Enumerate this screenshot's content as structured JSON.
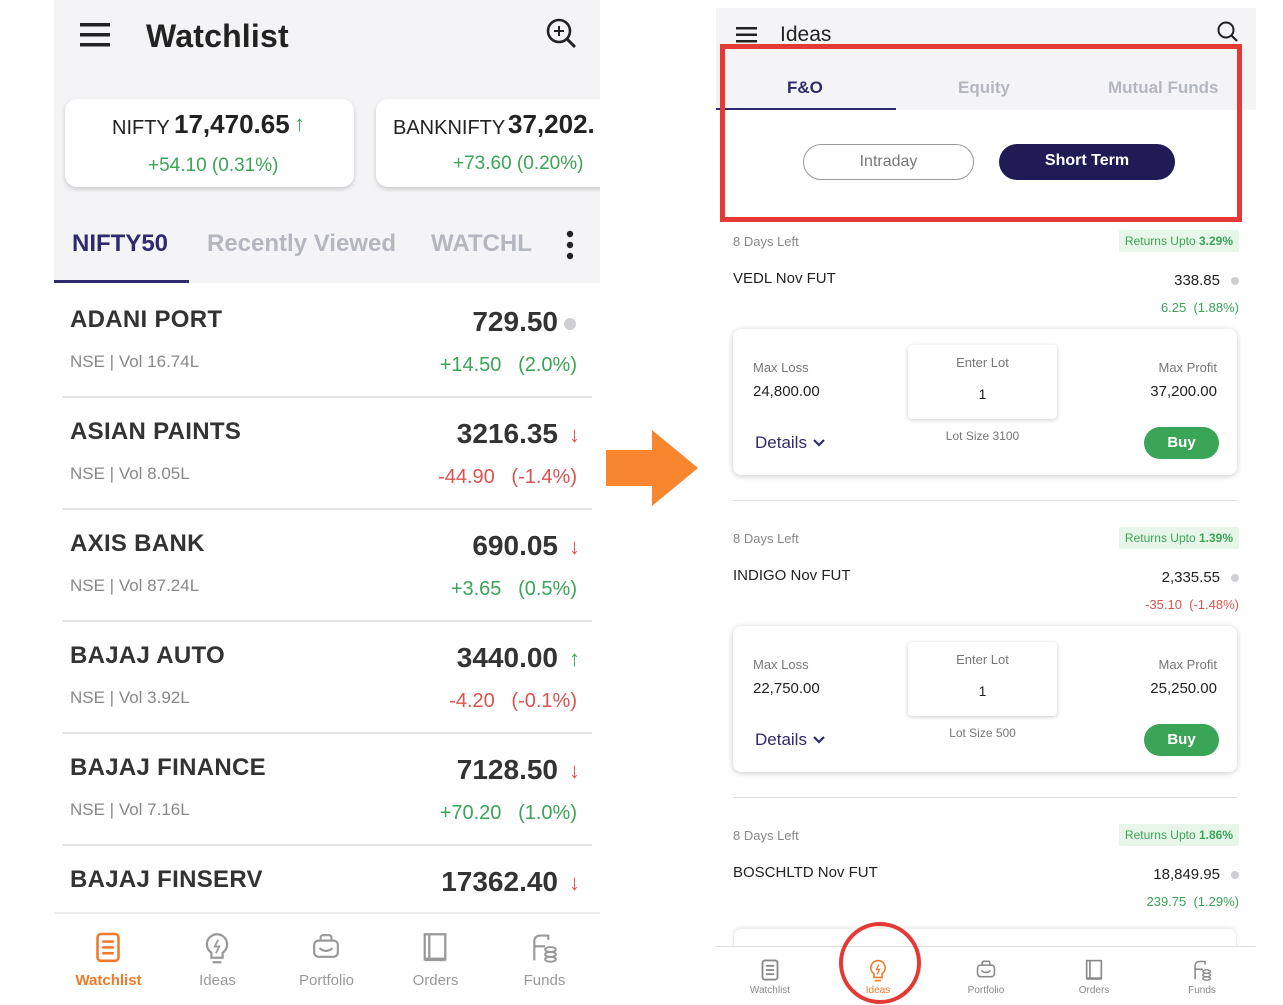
{
  "left": {
    "title": "Watchlist",
    "indices": [
      {
        "name": "NIFTY",
        "value": "17,470.65",
        "change": "+54.10 (0.31%)",
        "direction": "up"
      },
      {
        "name": "BANKNIFTY",
        "value": "37,202.",
        "change": "+73.60 (0.20%)",
        "direction": "none"
      }
    ],
    "tabs": [
      "NIFTY50",
      "Recently Viewed",
      "WATCHL"
    ],
    "stocks": [
      {
        "name": "ADANI PORT",
        "sub": "NSE | Vol 16.74L",
        "price": "729.50",
        "change": "+14.50   (2.0%)",
        "trend": "flat",
        "change_sign": "pos"
      },
      {
        "name": "ASIAN PAINTS",
        "sub": "NSE | Vol 8.05L",
        "price": "3216.35",
        "change": "-44.90   (-1.4%)",
        "trend": "down",
        "change_sign": "neg"
      },
      {
        "name": "AXIS BANK",
        "sub": "NSE | Vol 87.24L",
        "price": "690.05",
        "change": "+3.65   (0.5%)",
        "trend": "down",
        "change_sign": "pos"
      },
      {
        "name": "BAJAJ AUTO",
        "sub": "NSE | Vol 3.92L",
        "price": "3440.00",
        "change": "-4.20   (-0.1%)",
        "trend": "up",
        "change_sign": "neg"
      },
      {
        "name": "BAJAJ FINANCE",
        "sub": "NSE | Vol 7.16L",
        "price": "7128.50",
        "change": "+70.20   (1.0%)",
        "trend": "down",
        "change_sign": "pos"
      },
      {
        "name": "BAJAJ FINSERV",
        "sub": "",
        "price": "17362.40",
        "change": "",
        "trend": "down",
        "change_sign": "pos"
      }
    ],
    "nav": [
      {
        "label": "Watchlist",
        "icon": "watchlist-icon",
        "active": true
      },
      {
        "label": "Ideas",
        "icon": "bulb-icon",
        "active": false
      },
      {
        "label": "Portfolio",
        "icon": "portfolio-icon",
        "active": false
      },
      {
        "label": "Orders",
        "icon": "orders-icon",
        "active": false
      },
      {
        "label": "Funds",
        "icon": "funds-icon",
        "active": false
      }
    ]
  },
  "right": {
    "title": "Ideas",
    "tabs": [
      "F&O",
      "Equity",
      "Mutual Funds"
    ],
    "subtabs": [
      "Intraday",
      "Short Term"
    ],
    "ideas": [
      {
        "days": "8 Days Left",
        "returns_label": "Returns Upto",
        "returns_value": "3.29%",
        "symbol": "VEDL Nov FUT",
        "ltp": "338.85",
        "change": "6.25  (1.88%)",
        "change_sign": "pos",
        "max_loss_label": "Max Loss",
        "max_loss": "24,800.00",
        "enter_lot_label": "Enter Lot",
        "lot": "1",
        "lot_size": "Lot Size 3100",
        "max_profit_label": "Max Profit",
        "max_profit": "37,200.00",
        "details": "Details",
        "buy": "Buy"
      },
      {
        "days": "8 Days Left",
        "returns_label": "Returns Upto",
        "returns_value": "1.39%",
        "symbol": "INDIGO Nov FUT",
        "ltp": "2,335.55",
        "change": "-35.10  (-1.48%)",
        "change_sign": "neg",
        "max_loss_label": "Max Loss",
        "max_loss": "22,750.00",
        "enter_lot_label": "Enter Lot",
        "lot": "1",
        "lot_size": "Lot Size 500",
        "max_profit_label": "Max Profit",
        "max_profit": "25,250.00",
        "details": "Details",
        "buy": "Buy"
      },
      {
        "days": "8 Days Left",
        "returns_label": "Returns Upto",
        "returns_value": "1.86%",
        "symbol": "BOSCHLTD Nov FUT",
        "ltp": "18,849.95",
        "change": "239.75  (1.29%)",
        "change_sign": "pos"
      }
    ],
    "nav": [
      {
        "label": "Watchlist",
        "icon": "watchlist-icon",
        "active": false
      },
      {
        "label": "Ideas",
        "icon": "bulb-icon",
        "active": true
      },
      {
        "label": "Portfolio",
        "icon": "portfolio-icon",
        "active": false
      },
      {
        "label": "Orders",
        "icon": "orders-icon",
        "active": false
      },
      {
        "label": "Funds",
        "icon": "funds-icon",
        "active": false
      }
    ]
  },
  "colors": {
    "accent": "#2e2a6d",
    "positive": "#3aa457",
    "negative": "#d9534f",
    "active_nav": "#f07a2a",
    "highlight": "#e53935",
    "arrow": "#f7862f"
  }
}
